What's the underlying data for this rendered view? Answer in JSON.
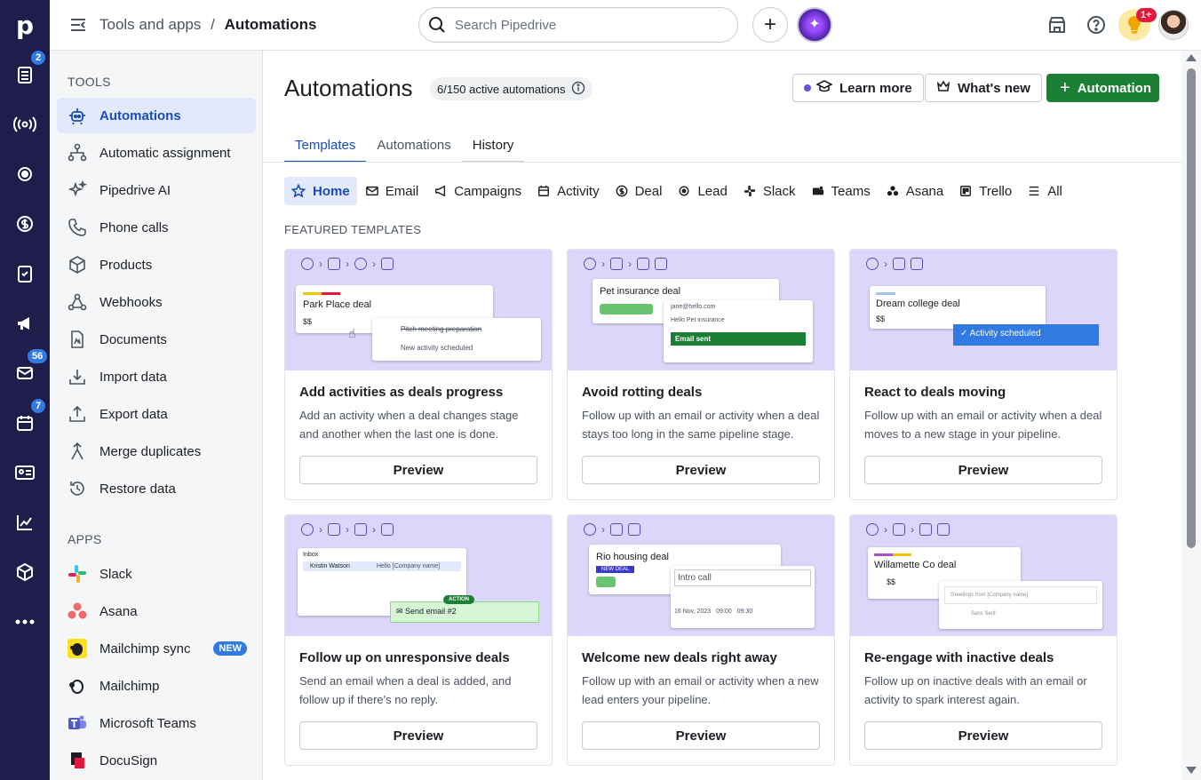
{
  "nav_rail": {
    "logo": "p",
    "badges": {
      "deals": "2",
      "mail": "56",
      "calendar": "7"
    }
  },
  "topbar": {
    "breadcrumb_parent": "Tools and apps",
    "breadcrumb_sep": "/",
    "breadcrumb_current": "Automations",
    "search_placeholder": "Search Pipedrive",
    "notif_badge": "1+"
  },
  "sidebar": {
    "tools_heading": "TOOLS",
    "tools": [
      "Automations",
      "Automatic assignment",
      "Pipedrive AI",
      "Phone calls",
      "Products",
      "Webhooks",
      "Documents",
      "Import data",
      "Export data",
      "Merge duplicates",
      "Restore data"
    ],
    "apps_heading": "APPS",
    "apps": [
      "Slack",
      "Asana",
      "Mailchimp sync",
      "Mailchimp",
      "Microsoft Teams",
      "DocuSign"
    ],
    "new_badge": "NEW"
  },
  "main": {
    "title": "Automations",
    "active_count": "6/150 active automations",
    "learn_more": "Learn more",
    "whats_new": "What's new",
    "add_automation": "Automation",
    "tabs": [
      "Templates",
      "Automations",
      "History"
    ],
    "categories": [
      "Home",
      "Email",
      "Campaigns",
      "Activity",
      "Deal",
      "Lead",
      "Slack",
      "Teams",
      "Asana",
      "Trello",
      "All"
    ],
    "featured_heading": "FEATURED TEMPLATES",
    "preview_label": "Preview",
    "cards": [
      {
        "title": "Add activities as deals progress",
        "desc": "Add an activity when a deal changes stage and another when the last one is done.",
        "deal": "Park Place deal",
        "l1": "Pitch meeting preparation",
        "l2": "New activity scheduled",
        "money": "$$"
      },
      {
        "title": "Avoid rotting deals",
        "desc": "Follow up with an email or activity when a deal stays too long in the same pipeline stage.",
        "deal": "Pet insurance deal",
        "l1": "jane@hello.com",
        "l2": "Hello Pet insurance",
        "l3": "Email sent"
      },
      {
        "title": "React to deals moving",
        "desc": "Follow up with an email or activity when a deal moves to a new stage in your pipeline.",
        "deal": "Dream college deal",
        "l1": "Activity scheduled",
        "money": "$$"
      },
      {
        "title": "Follow up on unresponsive deals",
        "desc": "Send an email when a deal is added, and follow up if there's no reply.",
        "deal": "Inbox",
        "l1": "Kristin Watson",
        "l2": "Hello [Company name]",
        "l3": "Send email #2",
        "tag": "ACTION"
      },
      {
        "title": "Welcome new deals right away",
        "desc": "Follow up with an email or activity when a new lead enters your pipeline.",
        "deal": "Rio housing deal",
        "tag": "NEW DEAL",
        "l1": "Intro call",
        "l2": "16 Nov, 2023",
        "l3": "09:00",
        "l4": "09:30"
      },
      {
        "title": "Re-engage with inactive deals",
        "desc": "Follow up on inactive deals with an email or activity to spark interest again.",
        "deal": "Willamette Co deal",
        "l1": "Greetings from [Company name]",
        "l2": "Sans Serif",
        "money": "$$"
      }
    ]
  }
}
